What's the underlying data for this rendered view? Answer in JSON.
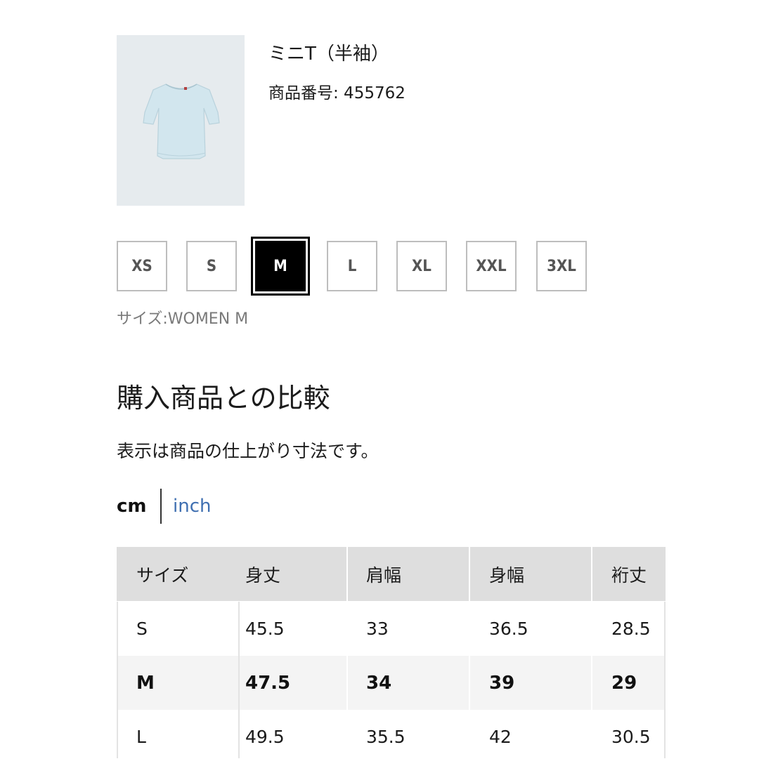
{
  "product": {
    "name": "ミニT（半袖）",
    "code": "商品番号: 455762",
    "image_alt": "light-blue-tshirt"
  },
  "sizes": {
    "options": [
      "XS",
      "S",
      "M",
      "L",
      "XL",
      "XXL",
      "3XL"
    ],
    "selected": "M",
    "caption": "サイズ:WOMEN M"
  },
  "comparison": {
    "title": "購入商品との比較",
    "note": "表示は商品の仕上がり寸法です。"
  },
  "units": {
    "active": "cm",
    "alternate": "inch"
  },
  "table": {
    "headers": [
      "サイズ",
      "身丈",
      "肩幅",
      "身幅",
      "裄丈"
    ],
    "rows": [
      [
        "S",
        "45.5",
        "33",
        "36.5",
        "28.5"
      ],
      [
        "M",
        "47.5",
        "34",
        "39",
        "29"
      ],
      [
        "L",
        "49.5",
        "35.5",
        "42",
        "30.5"
      ]
    ],
    "highlighted_row": "M"
  },
  "colors": {
    "link": "#3f6fb1",
    "header_bg": "#dedede",
    "highlight_row_bg": "#f4f4f4",
    "chip_border": "#bdbdbd",
    "shirt": "#d2e6ee"
  }
}
